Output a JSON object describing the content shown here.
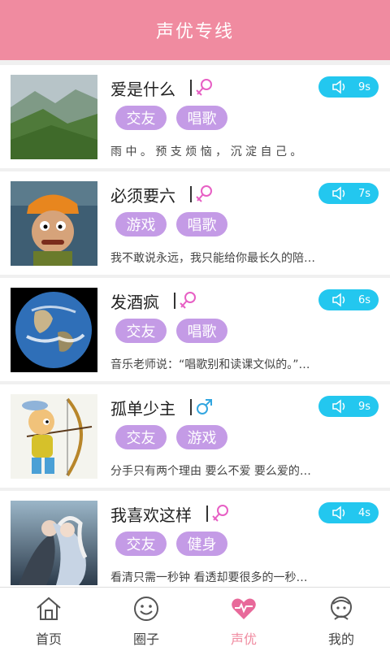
{
  "header": {
    "title": "声优专线"
  },
  "items": [
    {
      "name": "爱是什么",
      "gender": "female",
      "duration": "9s",
      "tags": [
        "交友",
        "唱歌"
      ],
      "desc": "雨 中 。 预 支 烦 恼 ， 沉 淀 自 己 。",
      "image": "landscape"
    },
    {
      "name": "必须要六",
      "gender": "female",
      "duration": "7s",
      "tags": [
        "游戏",
        "唱歌"
      ],
      "desc": "我不敢说永远，我只能给你最长久的陪…",
      "image": "cartoon-worker"
    },
    {
      "name": "发酒疯",
      "gender": "female",
      "duration": "6s",
      "tags": [
        "交友",
        "唱歌"
      ],
      "desc": "音乐老师说：“唱歌别和读课文似的。”…",
      "image": "earth"
    },
    {
      "name": "孤单少主",
      "gender": "male",
      "duration": "9s",
      "tags": [
        "交友",
        "游戏"
      ],
      "desc": "分手只有两个理由 要么不爱 要么爱的…",
      "image": "cartoon-archer"
    },
    {
      "name": "我喜欢这样",
      "gender": "female",
      "duration": "4s",
      "tags": [
        "交友",
        "健身"
      ],
      "desc": "看清只需一秒钟 看透却要很多的一秒…",
      "image": "fantasy"
    }
  ],
  "tabbar": {
    "tabs": [
      {
        "label": "首页",
        "icon": "home-icon"
      },
      {
        "label": "圈子",
        "icon": "smile-icon"
      },
      {
        "label": "声优",
        "icon": "heart-pulse-icon",
        "active": true
      },
      {
        "label": "我的",
        "icon": "user-icon"
      }
    ]
  },
  "colors": {
    "header": "#f08ba0",
    "duration": "#23c7ef",
    "tag": "#c49be6",
    "female": "#e75fc4",
    "male": "#33a6e0"
  }
}
